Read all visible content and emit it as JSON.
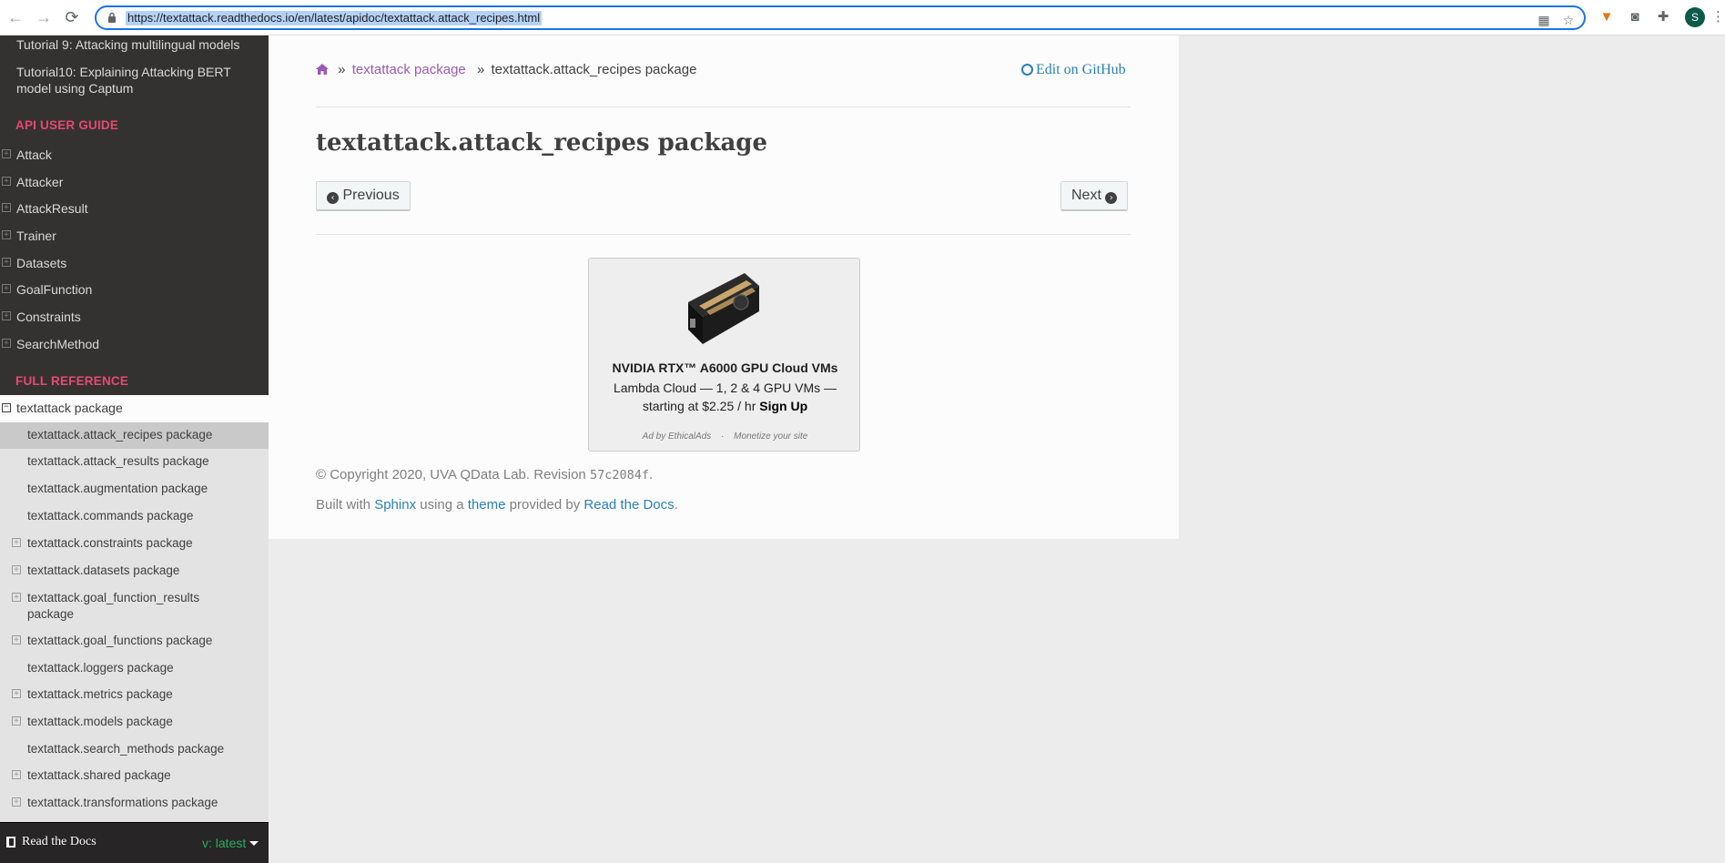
{
  "browser": {
    "url": "https://textattack.readthedocs.io/en/latest/apidoc/textattack.attack_recipes.html",
    "profile_initial": "S"
  },
  "sidebar": {
    "tutorials": [
      "Tutorial 9: Attacking multilingual models",
      "Tutorial10: Explaining Attacking BERT model using Captum"
    ],
    "api_caption": "API USER GUIDE",
    "api_items": [
      "Attack",
      "Attacker",
      "AttackResult",
      "Trainer",
      "Datasets",
      "GoalFunction",
      "Constraints",
      "SearchMethod"
    ],
    "full_caption": "FULL REFERENCE",
    "current_package": "textattack package",
    "sub_items": [
      {
        "label": "textattack.attack_recipes package",
        "expandable": false
      },
      {
        "label": "textattack.attack_results package",
        "expandable": false
      },
      {
        "label": "textattack.augmentation package",
        "expandable": false
      },
      {
        "label": "textattack.commands package",
        "expandable": false
      },
      {
        "label": "textattack.constraints package",
        "expandable": true
      },
      {
        "label": "textattack.datasets package",
        "expandable": true
      },
      {
        "label": "textattack.goal_function_results package",
        "expandable": true
      },
      {
        "label": "textattack.goal_functions package",
        "expandable": true
      },
      {
        "label": "textattack.loggers package",
        "expandable": false
      },
      {
        "label": "textattack.metrics package",
        "expandable": true
      },
      {
        "label": "textattack.models package",
        "expandable": true
      },
      {
        "label": "textattack.search_methods package",
        "expandable": false
      },
      {
        "label": "textattack.shared package",
        "expandable": true
      },
      {
        "label": "textattack.transformations package",
        "expandable": true
      }
    ],
    "rtd_label": "Read the Docs",
    "version": "v: latest"
  },
  "content": {
    "breadcrumb_sep": "»",
    "breadcrumb_parent": "textattack package",
    "breadcrumb_current": "textattack.attack_recipes package",
    "edit_github": "Edit on GitHub",
    "title": "textattack.attack_recipes package",
    "prev_label": "Previous",
    "next_label": "Next",
    "ad": {
      "title": "NVIDIA RTX™ A6000 GPU Cloud VMs",
      "body": "Lambda Cloud — 1, 2 & 4 GPU VMs — starting at $2.25 / hr",
      "cta": "Sign Up",
      "footer_left": "Ad by EthicalAds",
      "footer_dot": "·",
      "footer_right": "Monetize your site"
    },
    "copyright": "© Copyright 2020, UVA QData Lab. Revision",
    "revision": "57c2084f",
    "copyright_end": ".",
    "built_with": "Built with",
    "sphinx": "Sphinx",
    "using_a": "using a",
    "theme": "theme",
    "provided_by": "provided by",
    "rtd": "Read the Docs",
    "period": "."
  },
  "colors": {
    "sidebar_bg": "#343131",
    "caption": "#e54a6f",
    "link": "#2980b9",
    "visited": "#9b59b6",
    "version": "#27ae60"
  }
}
